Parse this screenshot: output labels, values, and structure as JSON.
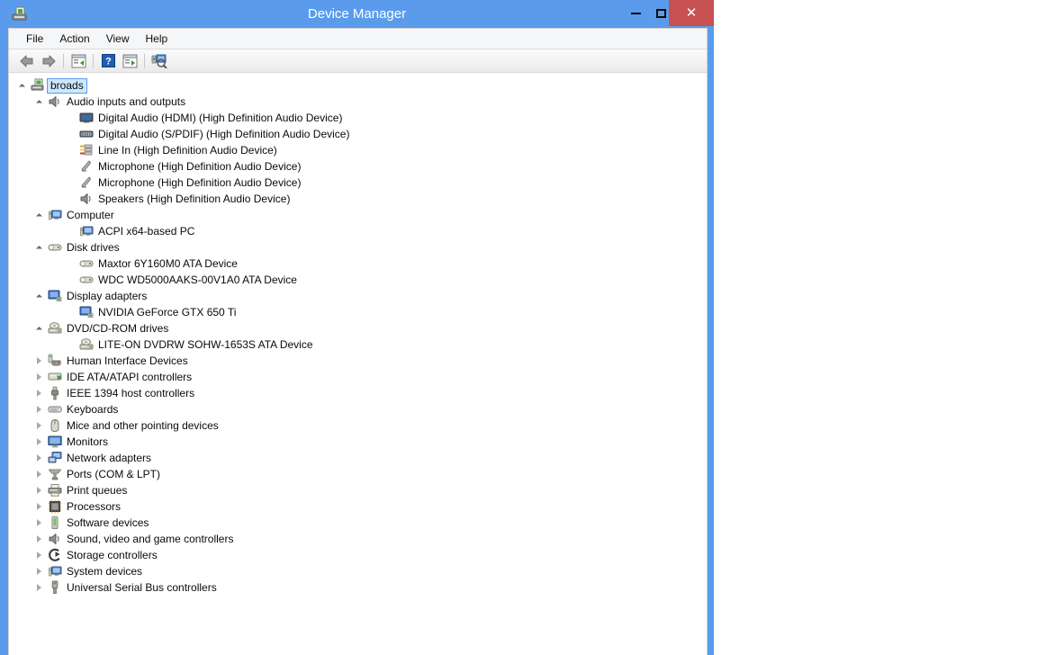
{
  "window": {
    "title": "Device Manager",
    "icon": "device-manager-icon",
    "controls": {
      "minimize": "minimize-button",
      "maximize": "maximize-button",
      "close": "close-button",
      "close_glyph": "✕",
      "accent_color": "#5a9ceb",
      "close_color": "#c75050"
    }
  },
  "menubar": {
    "items": [
      {
        "label": "File",
        "name": "menu-file"
      },
      {
        "label": "Action",
        "name": "menu-action"
      },
      {
        "label": "View",
        "name": "menu-view"
      },
      {
        "label": "Help",
        "name": "menu-help"
      }
    ]
  },
  "toolbar": {
    "buttons": [
      {
        "name": "back-button",
        "icon": "back-arrow-icon"
      },
      {
        "name": "forward-button",
        "icon": "forward-arrow-icon"
      },
      {
        "name": "separator-1",
        "icon": "separator"
      },
      {
        "name": "show-hide-console-tree-button",
        "icon": "console-tree-icon"
      },
      {
        "name": "separator-2",
        "icon": "separator"
      },
      {
        "name": "help-button",
        "icon": "question-mark-icon"
      },
      {
        "name": "properties-button",
        "icon": "properties-panel-icon"
      },
      {
        "name": "separator-3",
        "icon": "separator"
      },
      {
        "name": "scan-for-hardware-changes-button",
        "icon": "scan-hardware-icon"
      }
    ]
  },
  "tree": {
    "nodes": [
      {
        "level": 0,
        "state": "expanded",
        "icon": "computer-node-icon",
        "label": "broads",
        "selected": true
      },
      {
        "level": 1,
        "state": "expanded",
        "icon": "speaker-icon",
        "label": "Audio inputs and outputs",
        "selected": false
      },
      {
        "level": 2,
        "state": "leaf",
        "icon": "monitor-audio-icon",
        "label": "Digital Audio (HDMI) (High Definition Audio Device)",
        "selected": false
      },
      {
        "level": 2,
        "state": "leaf",
        "icon": "spdif-icon",
        "label": "Digital Audio (S/PDIF) (High Definition Audio Device)",
        "selected": false
      },
      {
        "level": 2,
        "state": "leaf",
        "icon": "line-in-jack-icon",
        "label": "Line In (High Definition Audio Device)",
        "selected": false
      },
      {
        "level": 2,
        "state": "leaf",
        "icon": "microphone-icon",
        "label": "Microphone (High Definition Audio Device)",
        "selected": false
      },
      {
        "level": 2,
        "state": "leaf",
        "icon": "microphone-icon",
        "label": "Microphone (High Definition Audio Device)",
        "selected": false
      },
      {
        "level": 2,
        "state": "leaf",
        "icon": "speaker-icon",
        "label": "Speakers (High Definition Audio Device)",
        "selected": false
      },
      {
        "level": 1,
        "state": "expanded",
        "icon": "computer-icon",
        "label": "Computer",
        "selected": false
      },
      {
        "level": 2,
        "state": "leaf",
        "icon": "computer-icon",
        "label": "ACPI x64-based PC",
        "selected": false
      },
      {
        "level": 1,
        "state": "expanded",
        "icon": "disk-drive-icon",
        "label": "Disk drives",
        "selected": false
      },
      {
        "level": 2,
        "state": "leaf",
        "icon": "disk-drive-icon",
        "label": "Maxtor 6Y160M0 ATA Device",
        "selected": false
      },
      {
        "level": 2,
        "state": "leaf",
        "icon": "disk-drive-icon",
        "label": "WDC WD5000AAKS-00V1A0 ATA Device",
        "selected": false
      },
      {
        "level": 1,
        "state": "expanded",
        "icon": "display-adapter-icon",
        "label": "Display adapters",
        "selected": false
      },
      {
        "level": 2,
        "state": "leaf",
        "icon": "display-adapter-icon",
        "label": "NVIDIA GeForce GTX 650 Ti",
        "selected": false
      },
      {
        "level": 1,
        "state": "expanded",
        "icon": "optical-drive-icon",
        "label": "DVD/CD-ROM drives",
        "selected": false
      },
      {
        "level": 2,
        "state": "leaf",
        "icon": "optical-drive-icon",
        "label": "LITE-ON DVDRW SOHW-1653S ATA Device",
        "selected": false
      },
      {
        "level": 1,
        "state": "collapsed",
        "icon": "hid-gamepad-icon",
        "label": "Human Interface Devices",
        "selected": false
      },
      {
        "level": 1,
        "state": "collapsed",
        "icon": "ide-controller-icon",
        "label": "IDE ATA/ATAPI controllers",
        "selected": false
      },
      {
        "level": 1,
        "state": "collapsed",
        "icon": "ieee1394-icon",
        "label": "IEEE 1394 host controllers",
        "selected": false
      },
      {
        "level": 1,
        "state": "collapsed",
        "icon": "keyboard-icon",
        "label": "Keyboards",
        "selected": false
      },
      {
        "level": 1,
        "state": "collapsed",
        "icon": "mouse-icon",
        "label": "Mice and other pointing devices",
        "selected": false
      },
      {
        "level": 1,
        "state": "collapsed",
        "icon": "monitor-icon",
        "label": "Monitors",
        "selected": false
      },
      {
        "level": 1,
        "state": "collapsed",
        "icon": "network-adapter-icon",
        "label": "Network adapters",
        "selected": false
      },
      {
        "level": 1,
        "state": "collapsed",
        "icon": "port-icon",
        "label": "Ports (COM & LPT)",
        "selected": false
      },
      {
        "level": 1,
        "state": "collapsed",
        "icon": "printer-icon",
        "label": "Print queues",
        "selected": false
      },
      {
        "level": 1,
        "state": "collapsed",
        "icon": "processor-icon",
        "label": "Processors",
        "selected": false
      },
      {
        "level": 1,
        "state": "collapsed",
        "icon": "software-device-icon",
        "label": "Software devices",
        "selected": false
      },
      {
        "level": 1,
        "state": "collapsed",
        "icon": "speaker-icon",
        "label": "Sound, video and game controllers",
        "selected": false
      },
      {
        "level": 1,
        "state": "collapsed",
        "icon": "storage-controller-icon",
        "label": "Storage controllers",
        "selected": false
      },
      {
        "level": 1,
        "state": "collapsed",
        "icon": "computer-icon",
        "label": "System devices",
        "selected": false
      },
      {
        "level": 1,
        "state": "collapsed",
        "icon": "usb-icon",
        "label": "Universal Serial Bus controllers",
        "selected": false
      }
    ]
  }
}
